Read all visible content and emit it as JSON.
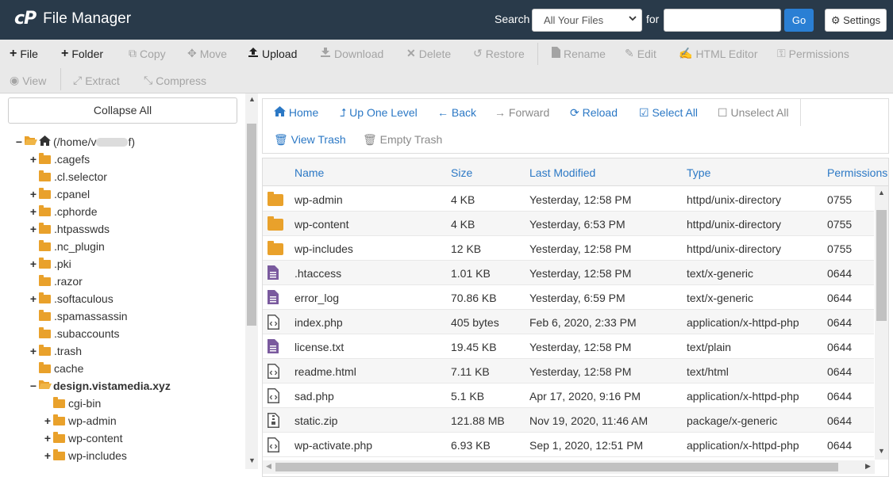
{
  "header": {
    "logo": "cP",
    "title": "File Manager",
    "search_label": "Search",
    "search_scope": "All Your Files",
    "for_label": "for",
    "search_value": "",
    "go_label": "Go",
    "settings_label": "Settings"
  },
  "toolbar": {
    "file": "File",
    "folder": "Folder",
    "copy": "Copy",
    "move": "Move",
    "upload": "Upload",
    "download": "Download",
    "delete": "Delete",
    "restore": "Restore",
    "rename": "Rename",
    "edit": "Edit",
    "html_editor": "HTML Editor",
    "permissions": "Permissions",
    "view": "View",
    "extract": "Extract",
    "compress": "Compress"
  },
  "tree": {
    "collapse_all": "Collapse All",
    "root_prefix": "(/home/v",
    "root_suffix": "f)",
    "items": [
      {
        "label": ".cagefs",
        "toggle": "+"
      },
      {
        "label": ".cl.selector",
        "toggle": ""
      },
      {
        "label": ".cpanel",
        "toggle": "+"
      },
      {
        "label": ".cphorde",
        "toggle": "+"
      },
      {
        "label": ".htpasswds",
        "toggle": "+"
      },
      {
        "label": ".nc_plugin",
        "toggle": ""
      },
      {
        "label": ".pki",
        "toggle": "+"
      },
      {
        "label": ".razor",
        "toggle": ""
      },
      {
        "label": ".softaculous",
        "toggle": "+"
      },
      {
        "label": ".spamassassin",
        "toggle": ""
      },
      {
        "label": ".subaccounts",
        "toggle": ""
      },
      {
        "label": ".trash",
        "toggle": "+"
      },
      {
        "label": "cache",
        "toggle": ""
      },
      {
        "label": "design.vistamedia.xyz",
        "toggle": "−"
      },
      {
        "label": "cgi-bin",
        "toggle": ""
      },
      {
        "label": "wp-admin",
        "toggle": "+"
      },
      {
        "label": "wp-content",
        "toggle": "+"
      },
      {
        "label": "wp-includes",
        "toggle": "+"
      }
    ]
  },
  "nav": {
    "home": "Home",
    "up_one_level": "Up One Level",
    "back": "Back",
    "forward": "Forward",
    "reload": "Reload",
    "select_all": "Select All",
    "unselect_all": "Unselect All",
    "view_trash": "View Trash",
    "empty_trash": "Empty Trash"
  },
  "table": {
    "columns": [
      "Name",
      "Size",
      "Last Modified",
      "Type",
      "Permissions"
    ],
    "rows": [
      {
        "icon": "folder",
        "name": "wp-admin",
        "size": "4 KB",
        "modified": "Yesterday, 12:58 PM",
        "type": "httpd/unix-directory",
        "perms": "0755"
      },
      {
        "icon": "folder",
        "name": "wp-content",
        "size": "4 KB",
        "modified": "Yesterday, 6:53 PM",
        "type": "httpd/unix-directory",
        "perms": "0755"
      },
      {
        "icon": "folder",
        "name": "wp-includes",
        "size": "12 KB",
        "modified": "Yesterday, 12:58 PM",
        "type": "httpd/unix-directory",
        "perms": "0755"
      },
      {
        "icon": "text",
        "name": ".htaccess",
        "size": "1.01 KB",
        "modified": "Yesterday, 12:58 PM",
        "type": "text/x-generic",
        "perms": "0644"
      },
      {
        "icon": "text",
        "name": "error_log",
        "size": "70.86 KB",
        "modified": "Yesterday, 6:59 PM",
        "type": "text/x-generic",
        "perms": "0644"
      },
      {
        "icon": "code",
        "name": "index.php",
        "size": "405 bytes",
        "modified": "Feb 6, 2020, 2:33 PM",
        "type": "application/x-httpd-php",
        "perms": "0644"
      },
      {
        "icon": "text",
        "name": "license.txt",
        "size": "19.45 KB",
        "modified": "Yesterday, 12:58 PM",
        "type": "text/plain",
        "perms": "0644"
      },
      {
        "icon": "code",
        "name": "readme.html",
        "size": "7.11 KB",
        "modified": "Yesterday, 12:58 PM",
        "type": "text/html",
        "perms": "0644"
      },
      {
        "icon": "code",
        "name": "sad.php",
        "size": "5.1 KB",
        "modified": "Apr 17, 2020, 9:16 PM",
        "type": "application/x-httpd-php",
        "perms": "0644"
      },
      {
        "icon": "zip",
        "name": "static.zip",
        "size": "121.88 MB",
        "modified": "Nov 19, 2020, 11:46 AM",
        "type": "package/x-generic",
        "perms": "0644"
      },
      {
        "icon": "code",
        "name": "wp-activate.php",
        "size": "6.93 KB",
        "modified": "Sep 1, 2020, 12:51 PM",
        "type": "application/x-httpd-php",
        "perms": "0644"
      }
    ]
  },
  "colors": {
    "header_bg": "#293a4a",
    "accent_blue": "#2b78c5",
    "folder": "#e9a12b",
    "doc_purple": "#7a5a9e",
    "go_button": "#2a7fd4"
  }
}
